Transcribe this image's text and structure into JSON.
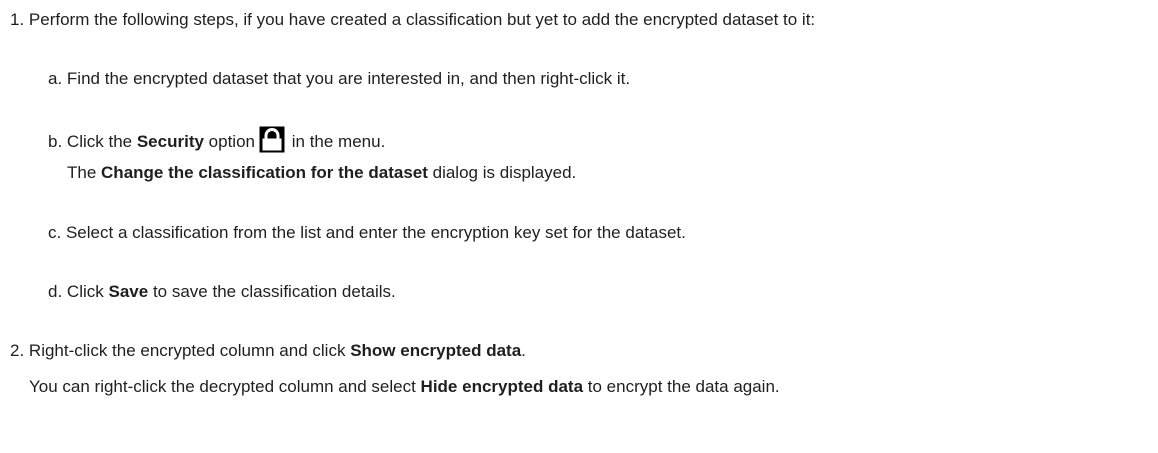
{
  "steps": [
    {
      "number": "1.",
      "text": "Perform the following steps, if you have created a classification but yet to add the encrypted dataset to it:",
      "substeps": [
        {
          "letter": "a.",
          "text": "Find the encrypted dataset that you are interested in, and then right-click it."
        },
        {
          "letter": "b.",
          "pre": "Click the",
          "bold": "Security",
          "post": "option",
          "icon": "lock-icon",
          "post2": "in the menu.",
          "result_pre": "The",
          "result_bold": "Change the classification for the dataset",
          "result_post": "dialog is displayed."
        },
        {
          "letter": "c.",
          "text": "Select a classification from the list and enter the encryption key set for the dataset."
        },
        {
          "letter": "d.",
          "pre": "Click",
          "bold": "Save",
          "post": "to save the classification details."
        }
      ]
    },
    {
      "number": "2.",
      "pre": "Right-click the encrypted column and click",
      "bold": "Show encrypted data",
      "post": ".",
      "result_pre": "You can right-click the decrypted column and select",
      "result_bold": "Hide encrypted data",
      "result_post": "to encrypt the data again."
    }
  ]
}
